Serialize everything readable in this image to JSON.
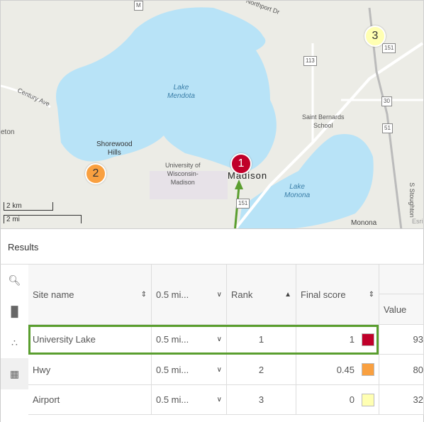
{
  "map": {
    "labels": {
      "lake_mendota": "Lake\nMendota",
      "lake_monona": "Lake\nMonona",
      "madison": "Madison",
      "shorewood": "Shorewood\nHills",
      "uw": "University of\nWisconsin-\nMadison",
      "saint_bernards": "Saint Bernards\nSchool",
      "century_ave": "Century Ave",
      "northport": "Northport Dr",
      "eton": "eton",
      "s_stoughton": "S Stoughton",
      "monona": "Monona",
      "esri": "Esri"
    },
    "shields": [
      "M",
      "113",
      "151",
      "30",
      "51",
      "151"
    ],
    "markers": [
      {
        "label": "1",
        "color": "#c0002a"
      },
      {
        "label": "2",
        "color": "#f9a040"
      },
      {
        "label": "3",
        "color": "#ffffb2"
      }
    ],
    "scale": {
      "km": "2 km",
      "mi": "2 mi"
    }
  },
  "results": {
    "title": "Results"
  },
  "sidebar": {
    "icons": [
      "zoom-chart-icon",
      "bar-chart-icon",
      "scatter-plot-icon",
      "table-icon"
    ]
  },
  "table": {
    "headers": {
      "site": "Site name",
      "dist": "0.5 mi...",
      "rank": "Rank",
      "score": "Final score",
      "value": "Value"
    },
    "rows": [
      {
        "site": "University Lake",
        "dist": "0.5 mi...",
        "rank": "1",
        "score": "1",
        "color": "#c0002a",
        "value": "93"
      },
      {
        "site": "Hwy",
        "dist": "0.5 mi...",
        "rank": "2",
        "score": "0.45",
        "color": "#f9a040",
        "value": "80"
      },
      {
        "site": "Airport",
        "dist": "0.5 mi...",
        "rank": "3",
        "score": "0",
        "color": "#ffffb2",
        "value": "32"
      }
    ]
  },
  "annotation": {
    "highlight_color": "#5a9e2f"
  }
}
